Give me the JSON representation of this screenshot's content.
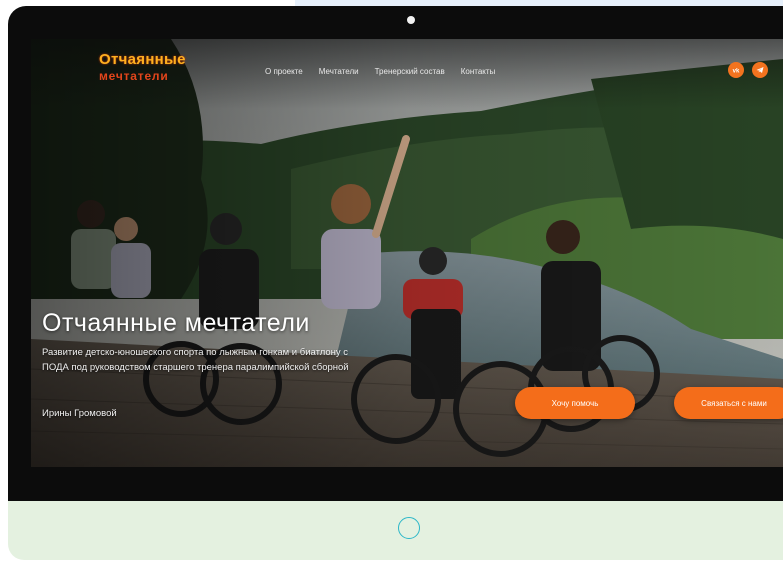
{
  "site": {
    "logo_line1": "Отчаянные",
    "logo_line2": "мечтатели"
  },
  "nav": {
    "items": [
      {
        "label": "О проекте"
      },
      {
        "label": "Мечтатели"
      },
      {
        "label": "Тренерский состав"
      },
      {
        "label": "Контакты"
      }
    ]
  },
  "social": {
    "icons": [
      "vk-icon",
      "telegram-icon"
    ],
    "accent": "#f46d1a"
  },
  "hero": {
    "title": "Отчаянные мечтатели",
    "description": "Развитие детско-юношеского спорта по лыжным гонкам и биатлону с ПОДА под руководством старшего тренера паралимпийской сборной",
    "signature": "Ирины Громовой",
    "primary_button": "Хочу помочь",
    "secondary_button": "Связаться с нами"
  },
  "colors": {
    "accent": "#f46d1a",
    "chin": "#e4f1e0",
    "home_button": "#2cb7c8",
    "logo_gold": "#ffb01f",
    "logo_red": "#e2451b"
  }
}
